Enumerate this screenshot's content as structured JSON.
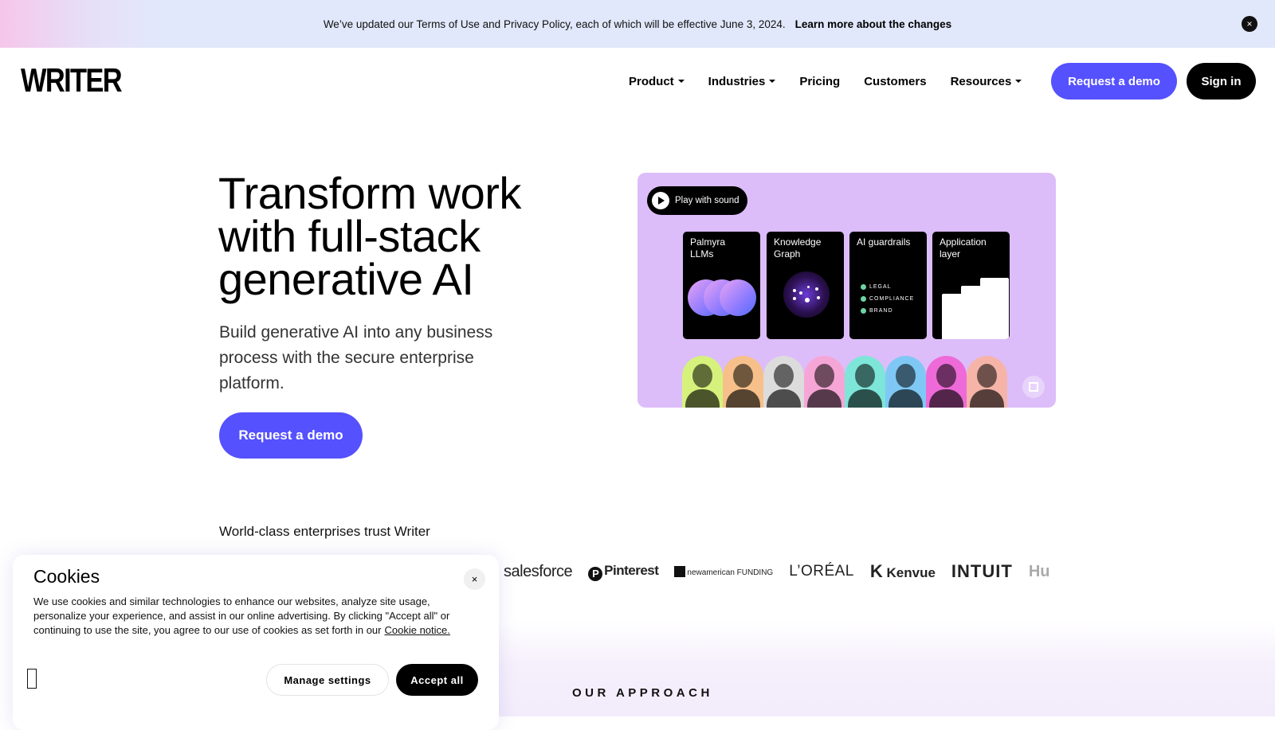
{
  "banner": {
    "message": "We’ve updated our Terms of Use and Privacy Policy, each of which will be effective June 3, 2024.",
    "link": "Learn more about the changes",
    "close_icon": "×"
  },
  "header": {
    "logo": "WRITER",
    "nav": [
      {
        "label": "Product",
        "dropdown": true
      },
      {
        "label": "Industries",
        "dropdown": true
      },
      {
        "label": "Pricing",
        "dropdown": false
      },
      {
        "label": "Customers",
        "dropdown": false
      },
      {
        "label": "Resources",
        "dropdown": true
      }
    ],
    "request_demo": "Request a demo",
    "sign_in": "Sign in"
  },
  "hero": {
    "title_lines": [
      "Transform work",
      "with full-stack",
      "generative AI"
    ],
    "subtitle": "Build generative AI into any business process with the secure enterprise platform.",
    "cta": "Request a demo",
    "trust_label": "World-class enterprises trust Writer"
  },
  "video": {
    "play_label": "Play with sound",
    "cards": [
      {
        "title": "Palmyra LLMs"
      },
      {
        "title": "Knowledge Graph"
      },
      {
        "title": "AI guardrails",
        "items": [
          "LEGAL",
          "COMPLIANCE",
          "BRAND"
        ]
      },
      {
        "title": "Application layer"
      }
    ],
    "face_colors": [
      "#d6f27c",
      "#f7c08a",
      "#dcdcdc",
      "#f5a6d6",
      "#7de6d8",
      "#7fc8f5",
      "#ee6ad8",
      "#f6b4a8"
    ]
  },
  "logos": [
    "salesforce",
    "Pinterest",
    "newamerican FUNDING",
    "L’ORÉAL",
    "Kenvue",
    "INTUIT",
    "Hu"
  ],
  "approach": "OUR APPROACH",
  "cookie": {
    "title": "Cookies",
    "text": "We use cookies and similar technologies to enhance our websites, analyze site usage, personalize your experience, and assist in our online advertising. By clicking \"Accept all\" or continuing to use the site, you agree to our use of cookies as set forth in our",
    "link": "Cookie notice.",
    "manage": "Manage settings",
    "accept": "Accept all",
    "close_icon": "×"
  },
  "colors": {
    "accent": "#5551ff",
    "video_bg": "#dcbdf9"
  }
}
